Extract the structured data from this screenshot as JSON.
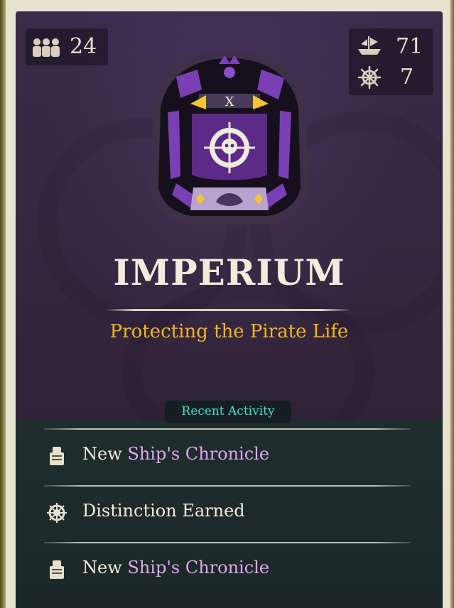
{
  "stats": {
    "members": "24",
    "ships": "71",
    "voyages": "7"
  },
  "emblem": {
    "banner_letter": "X"
  },
  "company": {
    "name": "IMPERIUM",
    "motto": "Protecting the Pirate Life"
  },
  "recent_activity": {
    "label": "Recent Activity",
    "items": [
      {
        "prefix": "New ",
        "highlight": "Ship's Chronicle",
        "icon": "chronicle-icon"
      },
      {
        "prefix": "Distinction Earned",
        "highlight": "",
        "icon": "distinction-icon"
      },
      {
        "prefix": "New ",
        "highlight": "Ship's Chronicle",
        "icon": "chronicle-icon"
      }
    ]
  },
  "colors": {
    "title": "#f2ecdc",
    "motto": "#f5b41e",
    "recent_label": "#3fe0cb",
    "highlight": "#e1a6ee",
    "card_purple": "#3b2b4c",
    "card_teal": "#1f2d2d"
  }
}
